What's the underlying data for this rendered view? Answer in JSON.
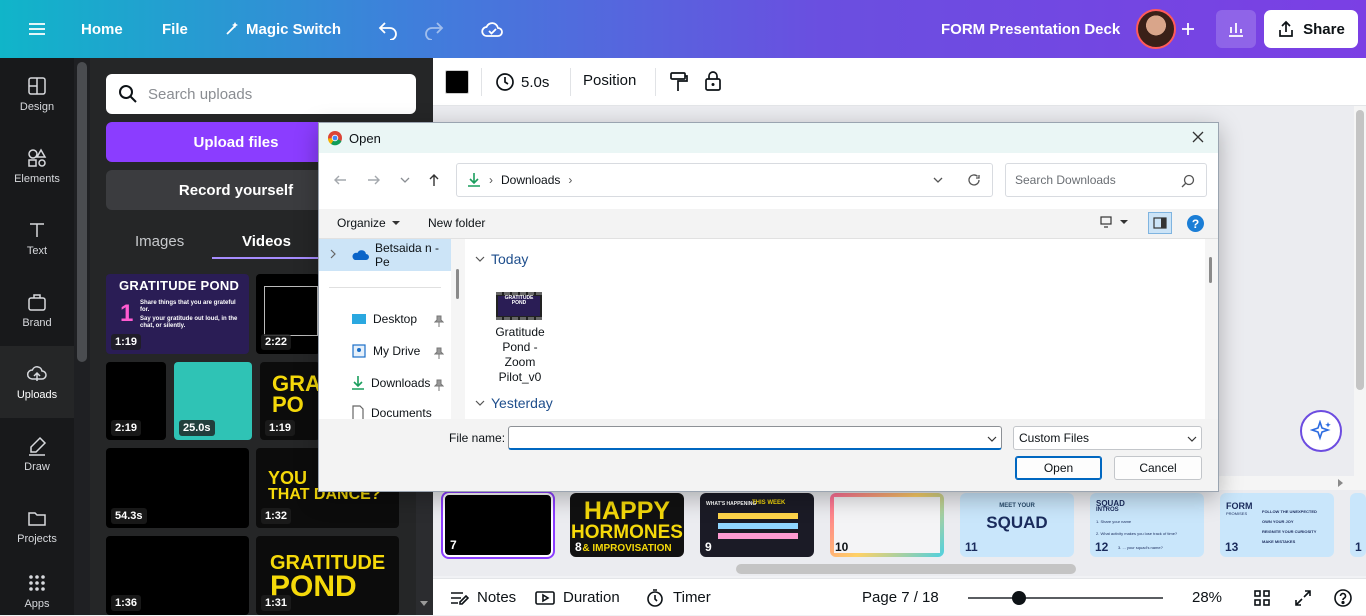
{
  "topbar": {
    "home": "Home",
    "file": "File",
    "magic_switch": "Magic Switch",
    "doc_title": "FORM Presentation Deck",
    "share": "Share"
  },
  "rail": {
    "items": [
      {
        "label": "Design"
      },
      {
        "label": "Elements"
      },
      {
        "label": "Text"
      },
      {
        "label": "Brand"
      },
      {
        "label": "Uploads"
      },
      {
        "label": "Draw"
      },
      {
        "label": "Projects"
      },
      {
        "label": "Apps"
      }
    ]
  },
  "panel": {
    "search_placeholder": "Search uploads",
    "upload_files": "Upload files",
    "record_yourself": "Record yourself",
    "tabs": [
      "Images",
      "Videos"
    ],
    "thumbs": [
      {
        "duration": "1:19",
        "title": "GRATITUDE POND",
        "line1": "Share things that you are grateful for.",
        "line2": "Say your gratitude out loud, in the chat, or silently.",
        "num": "1"
      },
      {
        "duration": "2:22"
      },
      {
        "duration": "2:19"
      },
      {
        "duration": "25.0s"
      },
      {
        "duration": "1:19",
        "text": "GRAT PO"
      },
      {
        "duration": "54.3s"
      },
      {
        "duration": "1:32",
        "text1": "YOU",
        "text2": "THAT DANCE?"
      },
      {
        "duration": "1:36"
      },
      {
        "duration": "1:31",
        "text1": "GRATITUDE",
        "text2": "POND"
      }
    ]
  },
  "toolbar": {
    "duration": "5.0s",
    "position": "Position"
  },
  "filmstrip": {
    "slides": [
      {
        "num": "7"
      },
      {
        "num": "8",
        "line1": "HAPPY",
        "line2": "HORMONES",
        "line3": "& IMPROVISATION"
      },
      {
        "num": "9",
        "header": "WHAT'S HAPPENING",
        "header2": "THIS WEEK"
      },
      {
        "num": "10"
      },
      {
        "num": "11",
        "kicker": "MEET YOUR",
        "title": "SQUAD"
      },
      {
        "num": "12",
        "title": "SQUAD",
        "sub": "INTROS",
        "q1": "1. Share your name",
        "q2": "2. What activity makes you lose track of time?",
        "q3": "3. ... your squad's name?"
      },
      {
        "num": "13",
        "title": "FORM",
        "sub": "PROMISES",
        "l1": "FOLLOW THE UNEXPECTED",
        "l2": "OWN YOUR JOY",
        "l3": "REIGNITE YOUR CURIOSITY",
        "l4": "MAKE MISTAKES"
      },
      {
        "num": "1"
      }
    ]
  },
  "bottombar": {
    "notes": "Notes",
    "duration": "Duration",
    "timer": "Timer",
    "page": "Page 7 / 18",
    "zoom": "28%",
    "zoom_level": 0.28
  },
  "dialog": {
    "title": "Open",
    "breadcrumb": "Downloads",
    "search_placeholder": "Search Downloads",
    "organize": "Organize",
    "new_folder": "New folder",
    "nav": {
      "onedrive": "Betsaida n - Pe",
      "items": [
        "Desktop",
        "My Drive",
        "Downloads",
        "Documents"
      ]
    },
    "groups": {
      "today": "Today",
      "yesterday": "Yesterday"
    },
    "file": {
      "name_lines": [
        "Gratitude",
        "Pond -",
        "Zoom",
        "Pilot_v0"
      ],
      "thumb_text": "GRATITUDE POND"
    },
    "file_name_label": "File name:",
    "file_name_value": "",
    "file_type": "Custom Files",
    "open": "Open",
    "cancel": "Cancel"
  },
  "colors": {
    "accent": "#8b3dff",
    "win_blue": "#0067c0"
  }
}
